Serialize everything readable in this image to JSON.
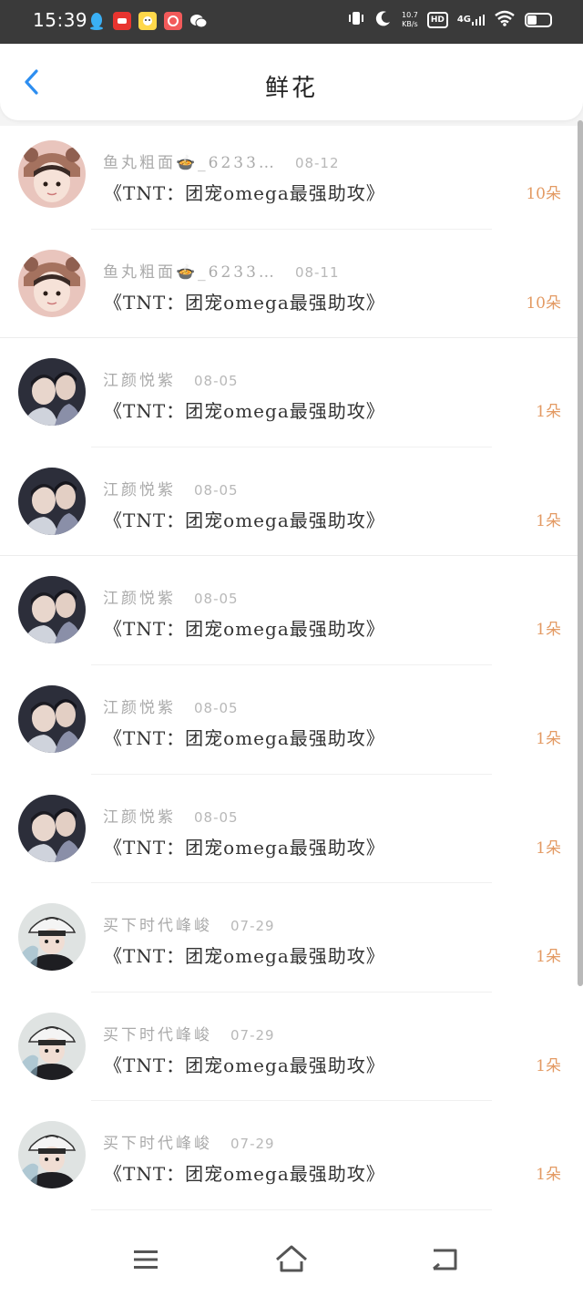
{
  "status_bar": {
    "time": "15:39",
    "net_speed": "10.7\nKB/s",
    "hd_label": "HD",
    "network_label": "4G"
  },
  "header": {
    "title": "鲜花"
  },
  "accent_color": "#2d8ef0",
  "count_color": "#e39a63",
  "items": [
    {
      "user": "鱼丸粗面🍲_6233…",
      "date": "08-12",
      "title": "《TNT：团宠omega最强助攻》",
      "count": "10朵",
      "avatar": "girl-avatar"
    },
    {
      "user": "鱼丸粗面🍲_6233…",
      "date": "08-11",
      "title": "《TNT：团宠omega最强助攻》",
      "count": "10朵",
      "avatar": "girl-avatar"
    },
    {
      "user": "江颜悦紫",
      "date": "08-05",
      "title": "《TNT：团宠omega最强助攻》",
      "count": "1朵",
      "avatar": "couple-avatar"
    },
    {
      "user": "江颜悦紫",
      "date": "08-05",
      "title": "《TNT：团宠omega最强助攻》",
      "count": "1朵",
      "avatar": "couple-avatar"
    },
    {
      "user": "江颜悦紫",
      "date": "08-05",
      "title": "《TNT：团宠omega最强助攻》",
      "count": "1朵",
      "avatar": "couple-avatar"
    },
    {
      "user": "江颜悦紫",
      "date": "08-05",
      "title": "《TNT：团宠omega最强助攻》",
      "count": "1朵",
      "avatar": "couple-avatar"
    },
    {
      "user": "江颜悦紫",
      "date": "08-05",
      "title": "《TNT：团宠omega最强助攻》",
      "count": "1朵",
      "avatar": "couple-avatar"
    },
    {
      "user": "买下时代峰峻",
      "date": "07-29",
      "title": "《TNT：团宠omega最强助攻》",
      "count": "1朵",
      "avatar": "boy-cap-avatar"
    },
    {
      "user": "买下时代峰峻",
      "date": "07-29",
      "title": "《TNT：团宠omega最强助攻》",
      "count": "1朵",
      "avatar": "boy-cap-avatar"
    },
    {
      "user": "买下时代峰峻",
      "date": "07-29",
      "title": "《TNT：团宠omega最强助攻》",
      "count": "1朵",
      "avatar": "boy-cap-avatar"
    }
  ]
}
